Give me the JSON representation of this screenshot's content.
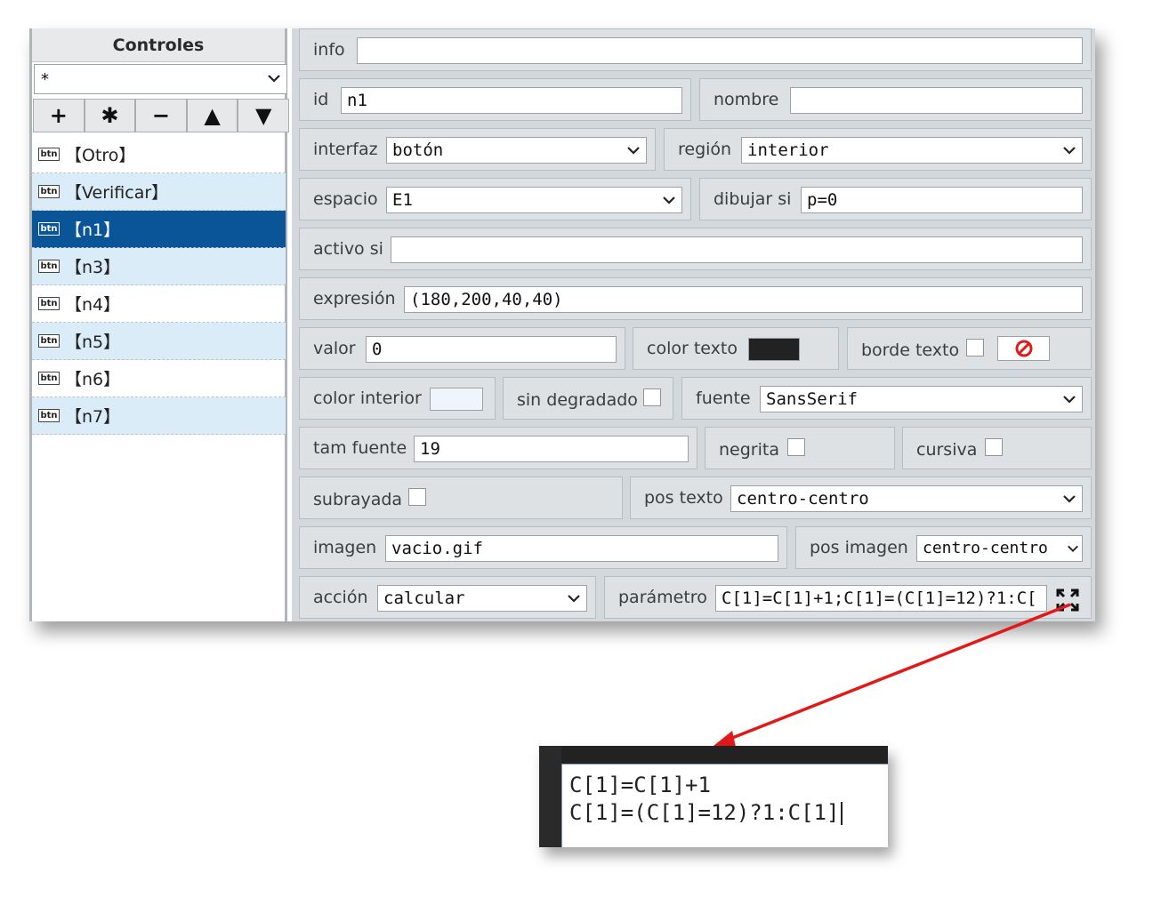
{
  "sidebar": {
    "title": "Controles",
    "filter_value": "*",
    "tools": [
      "+",
      "✱",
      "−",
      "▲",
      "▼"
    ],
    "items": [
      {
        "badge": "btn",
        "label": "【Otro】"
      },
      {
        "badge": "btn",
        "label": "【Verificar】"
      },
      {
        "badge": "btn",
        "label": "【n1】"
      },
      {
        "badge": "btn",
        "label": "【n3】"
      },
      {
        "badge": "btn",
        "label": "【n4】"
      },
      {
        "badge": "btn",
        "label": "【n5】"
      },
      {
        "badge": "btn",
        "label": "【n6】"
      },
      {
        "badge": "btn",
        "label": "【n7】"
      }
    ],
    "selected_index": 2
  },
  "form": {
    "info": {
      "label": "info",
      "value": ""
    },
    "id": {
      "label": "id",
      "value": "n1"
    },
    "nombre": {
      "label": "nombre",
      "value": ""
    },
    "interfaz": {
      "label": "interfaz",
      "value": "botón"
    },
    "region": {
      "label": "región",
      "value": "interior"
    },
    "espacio": {
      "label": "espacio",
      "value": "E1"
    },
    "dibujar_si": {
      "label": "dibujar si",
      "value": "p=0"
    },
    "activo_si": {
      "label": "activo si",
      "value": ""
    },
    "expresion": {
      "label": "expresión",
      "value": "(180,200,40,40)"
    },
    "valor": {
      "label": "valor",
      "value": "0"
    },
    "color_texto": {
      "label": "color texto",
      "color": "#222222"
    },
    "borde_texto": {
      "label": "borde texto",
      "checked": false,
      "color_state": "none"
    },
    "color_interior": {
      "label": "color interior",
      "color": "#eef5fb"
    },
    "sin_degradado": {
      "label": "sin degradado",
      "checked": false
    },
    "fuente": {
      "label": "fuente",
      "value": "SansSerif"
    },
    "tam_fuente": {
      "label": "tam fuente",
      "value": "19"
    },
    "negrita": {
      "label": "negrita",
      "checked": false
    },
    "cursiva": {
      "label": "cursiva",
      "checked": false
    },
    "subrayada": {
      "label": "subrayada",
      "checked": false
    },
    "pos_texto": {
      "label": "pos texto",
      "value": "centro-centro"
    },
    "imagen": {
      "label": "imagen",
      "value": "vacio.gif"
    },
    "pos_imagen": {
      "label": "pos imagen",
      "value": "centro-centro"
    },
    "accion": {
      "label": "acción",
      "value": "calcular"
    },
    "parametro": {
      "label": "parámetro",
      "value": "C[1]=C[1]+1;C[1]=(C[1]=12)?1:C["
    }
  },
  "popup": {
    "lines": [
      "C[1]=C[1]+1",
      "C[1]=(C[1]=12)?1:C[1]"
    ]
  },
  "colors": {
    "selected_row": "#0a5598",
    "alt_row": "#d9ecf7",
    "panel_bg": "#d3d8dc",
    "arrow": "#e01a1a"
  }
}
